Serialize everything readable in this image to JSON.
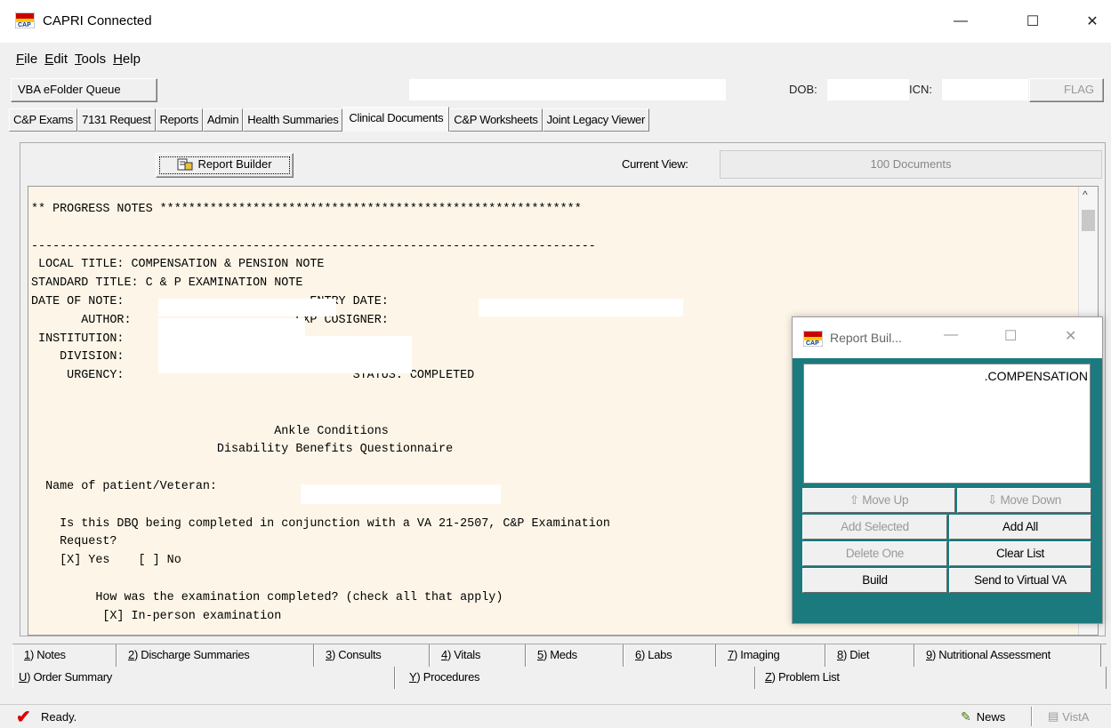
{
  "window": {
    "title": "CAPRI Connected",
    "controls": {
      "minimize": "—",
      "maximize": "☐",
      "close": "✕"
    }
  },
  "menu": [
    {
      "prefix": "F",
      "rest": "ile"
    },
    {
      "prefix": "E",
      "rest": "dit"
    },
    {
      "prefix": "T",
      "rest": "ools"
    },
    {
      "prefix": "H",
      "rest": "elp"
    }
  ],
  "patient_bar": {
    "queue_button": "VBA eFolder Queue",
    "dob_label": "DOB:",
    "icn_label": "ICN:",
    "flag_button": "FLAG"
  },
  "tabs": [
    {
      "label": "C&P Exams",
      "active": false
    },
    {
      "label": "7131 Request",
      "active": false
    },
    {
      "label": "Reports",
      "active": false
    },
    {
      "label": "Admin",
      "active": false
    },
    {
      "label": "Health Summaries",
      "active": false
    },
    {
      "label": "Clinical Documents",
      "active": true
    },
    {
      "label": "C&P Worksheets",
      "active": false
    },
    {
      "label": "Joint Legacy Viewer",
      "active": false
    }
  ],
  "toolbar": {
    "report_builder_button": "Report Builder",
    "current_view_label": "Current View:",
    "current_view_value": "100 Documents"
  },
  "document": {
    "lines": [
      "** PROGRESS NOTES ***********************************************************",
      "",
      "-------------------------------------------------------------------------------",
      " LOCAL TITLE: COMPENSATION & PENSION NOTE",
      "STANDARD TITLE: C & P EXAMINATION NOTE",
      "DATE OF NOTE:                          ENTRY DATE:",
      "       AUTHOR:                       EXP COSIGNER:",
      " INSTITUTION:",
      "    DIVISION:",
      "     URGENCY:                                STATUS: COMPLETED",
      "",
      "",
      "                                  Ankle Conditions",
      "                          Disability Benefits Questionnaire",
      "",
      "  Name of patient/Veteran:",
      "",
      "    Is this DBQ being completed in conjunction with a VA 21-2507, C&P Examination",
      "    Request?",
      "    [X] Yes    [ ] No",
      "",
      "         How was the examination completed? (check all that apply)",
      "          [X] In-person examination"
    ]
  },
  "bottom_tabs_row1": [
    {
      "key": "1",
      "label": "Notes"
    },
    {
      "key": "2",
      "label": "Discharge Summaries"
    },
    {
      "key": "3",
      "label": "Consults"
    },
    {
      "key": "4",
      "label": "Vitals"
    },
    {
      "key": "5",
      "label": "Meds"
    },
    {
      "key": "6",
      "label": "Labs"
    },
    {
      "key": "7",
      "label": "Imaging"
    },
    {
      "key": "8",
      "label": "Diet"
    },
    {
      "key": "9",
      "label": "Nutritional Assessment"
    }
  ],
  "bottom_tabs_row2": [
    {
      "key": "U",
      "label": "Order Summary"
    },
    {
      "key": "Y",
      "label": "Procedures"
    },
    {
      "key": "Z",
      "label": "Problem List"
    }
  ],
  "status_bar": {
    "status_text": "Ready.",
    "news_label": "News",
    "vista_label": "VistA"
  },
  "report_builder_window": {
    "title": "Report Buil...",
    "list_item": ".COMPENSATION",
    "buttons": {
      "move_up": "Move Up",
      "move_down": "Move Down",
      "add_selected": "Add Selected",
      "add_all": "Add All",
      "delete_one": "Delete One",
      "clear_list": "Clear List",
      "build": "Build",
      "send_virtual_va": "Send to Virtual VA"
    }
  },
  "colors": {
    "document_bg": "#fdf6e8",
    "report_builder_frame": "#1b7a7e",
    "status_check": "#dd0000"
  }
}
